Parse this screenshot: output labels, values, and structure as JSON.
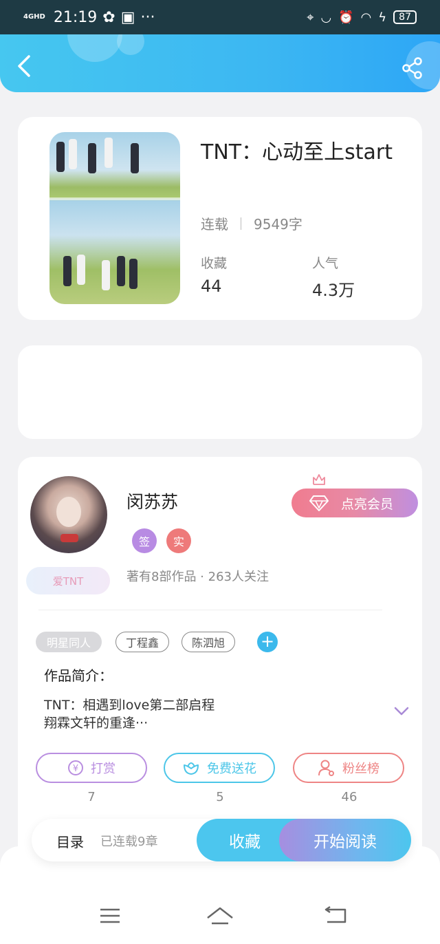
{
  "status_bar": {
    "network": "4GHD",
    "time": "21:19",
    "more": "···",
    "battery": "87"
  },
  "book": {
    "title": "TNT：心动至上start",
    "status": "连载",
    "word_count": "9549字",
    "stats": [
      {
        "label": "收藏",
        "value": "44"
      },
      {
        "label": "人气",
        "value": "4.3万"
      }
    ]
  },
  "author": {
    "name": "闵苏苏",
    "badges": [
      {
        "label": "签",
        "color": "#b88be3"
      },
      {
        "label": "实",
        "color": "#ee7a7a"
      }
    ],
    "fan_badge": "爱TNT",
    "summary": "著有8部作品 · 263人关注",
    "vip_button": "点亮会员"
  },
  "tags": [
    "明星同人",
    "丁程鑫",
    "陈泗旭"
  ],
  "intro": {
    "label": "作品简介：",
    "line1": "TNT：相遇到love第二部启程",
    "line2": "翔霖文轩的重逢···"
  },
  "actions": [
    {
      "label": "打赏",
      "count": "7",
      "color": "#b98ee0"
    },
    {
      "label": "免费送花",
      "count": "5",
      "color": "#4cc6e8"
    },
    {
      "label": "粉丝榜",
      "count": "46",
      "color": "#ee8484"
    }
  ],
  "bottom_bar": {
    "toc": "目录",
    "toc_status": "已连载9章",
    "collect": "收藏",
    "read": "开始阅读"
  },
  "colors": {
    "header_accent": "#3cb7f2",
    "read_gradient_start": "#a68ee0",
    "collect": "#4cc6ee"
  }
}
